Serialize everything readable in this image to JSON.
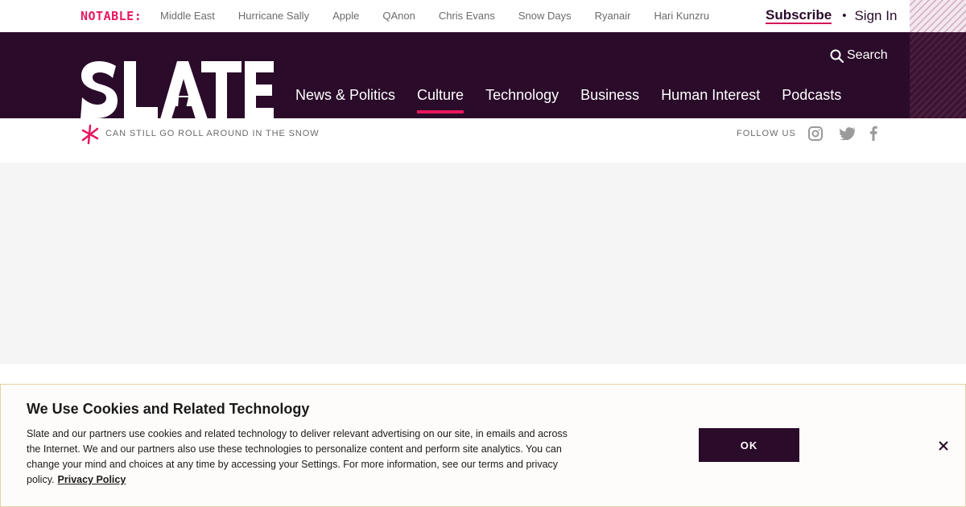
{
  "topbar": {
    "notable_label": "NOTABLE:",
    "links": [
      "Middle East",
      "Hurricane Sally",
      "Apple",
      "QAnon",
      "Chris Evans",
      "Snow Days",
      "Ryanair",
      "Hari Kunzru"
    ],
    "subscribe_label": "Subscribe",
    "separator": "•",
    "signin_label": "Sign In"
  },
  "header": {
    "logo_text": "SLATE",
    "search_label": "Search",
    "nav": [
      "News & Politics",
      "Culture",
      "Technology",
      "Business",
      "Human Interest",
      "Podcasts"
    ],
    "active_nav": "Culture"
  },
  "subbar": {
    "tagline": "Can still go roll around in the snow",
    "follow_label": "Follow us",
    "social_icons": [
      "instagram-icon",
      "twitter-icon",
      "facebook-icon"
    ]
  },
  "cookie": {
    "title": "We Use Cookies and Related Technology",
    "body": "Slate and our partners use cookies and related technology to deliver relevant advertising on our site, in emails and across the Internet. We and our partners also use these technologies to personalize content and perform site analytics. You can change your mind and choices at any time by accessing your Settings. For more information, see our terms and privacy policy.",
    "privacy_label": "Privacy Policy",
    "ok_label": "OK"
  },
  "colors": {
    "brand_dark": "#2a0b2a",
    "accent_pink": "#e8175d",
    "notable_pink": "#e8175d"
  }
}
